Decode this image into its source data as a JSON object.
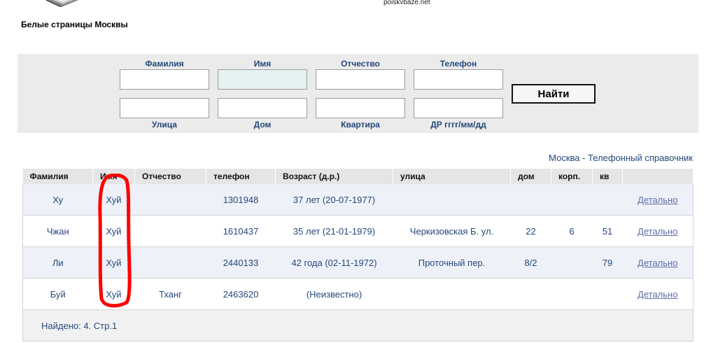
{
  "header": {
    "logo_text": "Белые страницы Москвы",
    "site_domain": "poiskvbaze.net"
  },
  "search": {
    "labels_top": [
      "Фамилия",
      "Имя",
      "Отчество",
      "Телефон"
    ],
    "labels_bottom": [
      "Улица",
      "Дом",
      "Квартира",
      "ДР гггг/мм/дд"
    ],
    "values_top": [
      "",
      "",
      "",
      ""
    ],
    "values_bottom": [
      "",
      "",
      "",
      ""
    ],
    "submit_label": "Найти"
  },
  "directory_link": "Москва - Телефонный справочник",
  "table": {
    "headers": [
      "Фамилия",
      "Имя",
      "Отчество",
      "телефон",
      "Возраст (д.р.)",
      "улица",
      "дом",
      "корп.",
      "кв",
      ""
    ],
    "rows": [
      [
        "Ху",
        "Хуй",
        "",
        "1301948",
        "37 лет (20-07-1977)",
        "",
        "",
        "",
        "",
        "Детально"
      ],
      [
        "Чжан",
        "Хуй",
        "",
        "1610437",
        "35 лет (21-01-1979)",
        "Черкизовская Б. ул.",
        "22",
        "6",
        "51",
        "Детально"
      ],
      [
        "Ли",
        "Хуй",
        "",
        "2440133",
        "42 года (02-11-1972)",
        "Проточный пер.",
        "8/2",
        "",
        "79",
        "Детально"
      ],
      [
        "Буй",
        "Хуй",
        "Тханг",
        "2463620",
        "(Неизвестно)",
        "",
        "",
        "",
        "",
        "Детально"
      ]
    ],
    "found_text": "Найдено: 4. Стр.1"
  },
  "colors": {
    "panel_bg": "#ebebeb",
    "label_blue": "#24487a",
    "row_odd": "#eef1f8",
    "highlight_red": "#ff0000"
  }
}
